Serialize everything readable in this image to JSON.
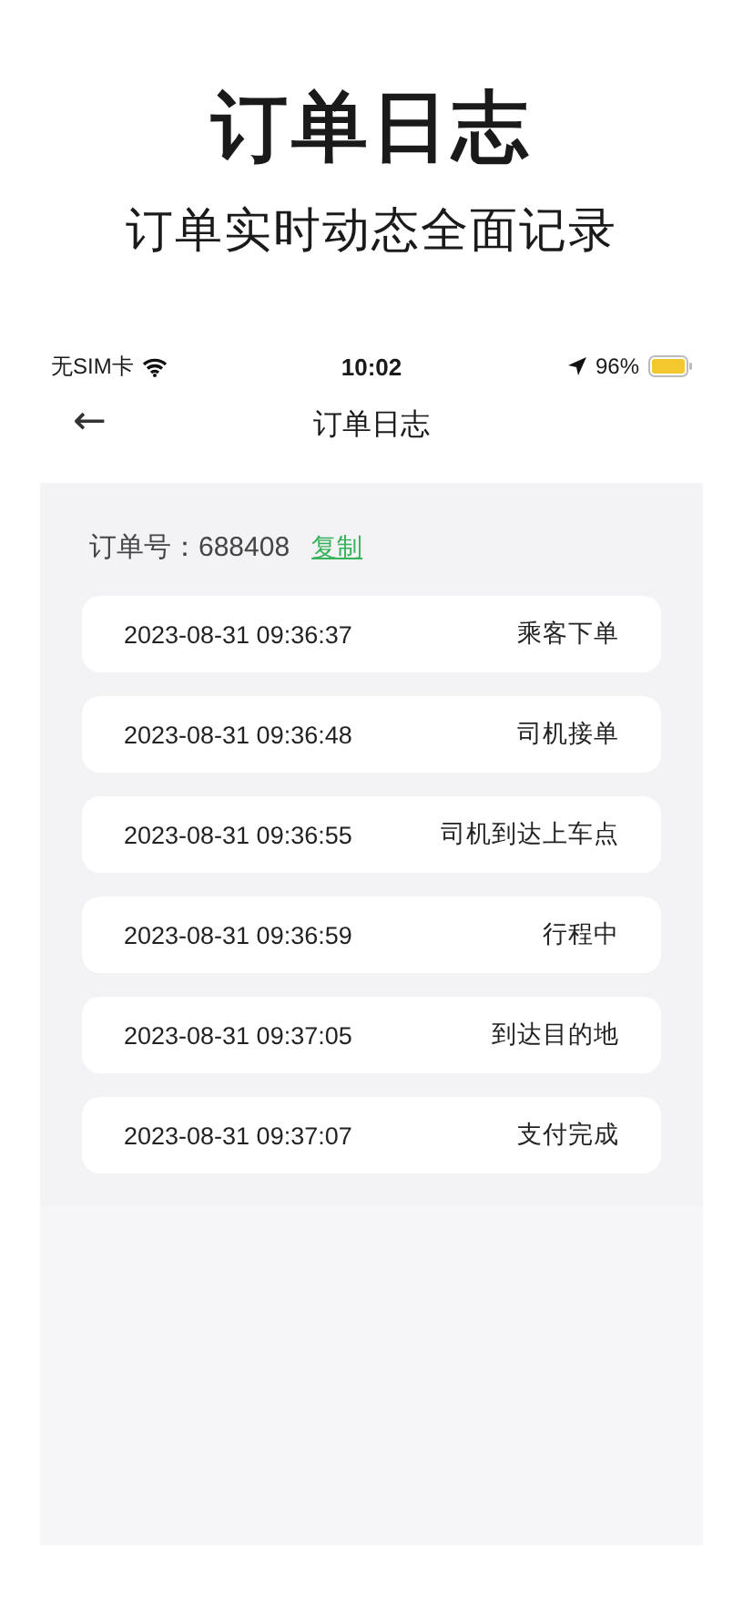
{
  "promo": {
    "title": "订单日志",
    "subtitle": "订单实时动态全面记录"
  },
  "status_bar": {
    "carrier": "无SIM卡",
    "time": "10:02",
    "battery": "96%"
  },
  "nav": {
    "back": "←",
    "title": "订单日志"
  },
  "order": {
    "label": "订单号：688408",
    "copy": "复制"
  },
  "logs": [
    {
      "time": "2023-08-31 09:36:37",
      "event": "乘客下单"
    },
    {
      "time": "2023-08-31 09:36:48",
      "event": "司机接单"
    },
    {
      "time": "2023-08-31 09:36:55",
      "event": "司机到达上车点"
    },
    {
      "time": "2023-08-31 09:36:59",
      "event": "行程中"
    },
    {
      "time": "2023-08-31 09:37:05",
      "event": "到达目的地"
    },
    {
      "time": "2023-08-31 09:37:07",
      "event": "支付完成"
    }
  ]
}
